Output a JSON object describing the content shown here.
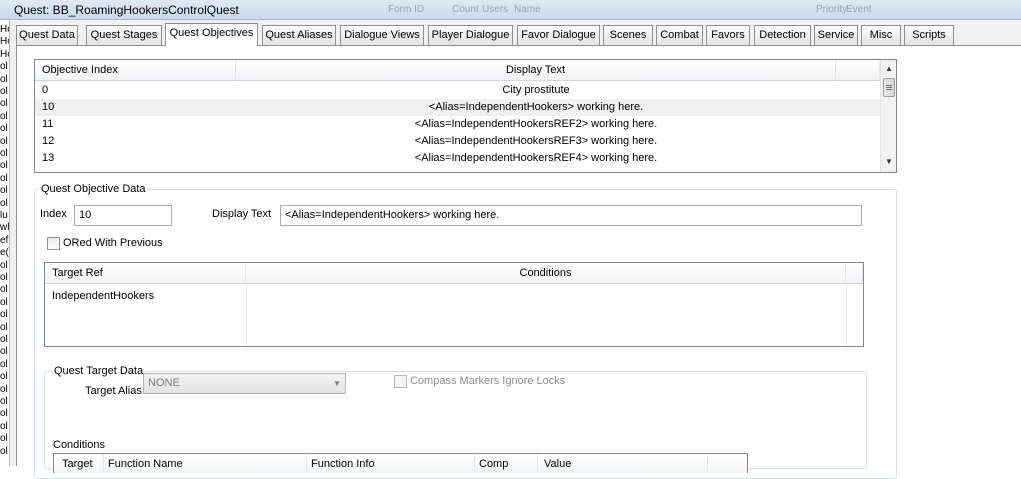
{
  "window": {
    "title": "Quest: BB_RoamingHookersControlQuest",
    "ghost_columns": [
      "Form ID",
      "Count",
      "Users",
      "Name",
      "Priority",
      "Event"
    ]
  },
  "background_strip": [
    "Ho",
    "Ho",
    "Ho",
    "ol",
    "ol",
    "ol",
    "ol",
    "ol",
    "ol",
    "ol",
    "ol",
    "ol",
    "ol",
    "ol",
    "ol",
    "lu",
    "wl",
    "ef",
    "e(",
    "ol",
    "ol",
    "ol",
    "ol",
    "ol",
    "ol",
    "ol",
    "ol",
    "ol",
    "ol",
    "ol",
    "ol",
    "ol",
    "ol",
    "ol",
    "ol"
  ],
  "tabs": [
    {
      "label": "Quest Data",
      "active": false
    },
    {
      "label": "Quest Stages",
      "active": false
    },
    {
      "label": "Quest Objectives",
      "active": true
    },
    {
      "label": "Quest Aliases",
      "active": false
    },
    {
      "label": "Dialogue Views",
      "active": false
    },
    {
      "label": "Player Dialogue",
      "active": false
    },
    {
      "label": "Favor Dialogue",
      "active": false
    },
    {
      "label": "Scenes",
      "active": false
    },
    {
      "label": "Combat",
      "active": false
    },
    {
      "label": "Favors",
      "active": false
    },
    {
      "label": "Detection",
      "active": false
    },
    {
      "label": "Service",
      "active": false
    },
    {
      "label": "Misc",
      "active": false
    },
    {
      "label": "Scripts",
      "active": false
    }
  ],
  "objectives_list": {
    "columns": [
      "Objective Index",
      "Display Text"
    ],
    "rows": [
      {
        "index": "0",
        "text": "City prostitute",
        "selected": false
      },
      {
        "index": "10",
        "text": "<Alias=IndependentHookers> working here.",
        "selected": true
      },
      {
        "index": "11",
        "text": "<Alias=IndependentHookersREF2> working here.",
        "selected": false
      },
      {
        "index": "12",
        "text": "<Alias=IndependentHookersREF3> working here.",
        "selected": false
      },
      {
        "index": "13",
        "text": "<Alias=IndependentHookersREF4> working here.",
        "selected": false
      }
    ]
  },
  "objective_data": {
    "group_label": "Quest Objective Data",
    "index_label": "Index",
    "index_value": "10",
    "display_text_label": "Display Text",
    "display_text_value": "<Alias=IndependentHookers> working here.",
    "ored_label": "ORed With Previous",
    "ored_checked": false
  },
  "targets_list": {
    "columns": [
      "Target Ref",
      "Conditions"
    ],
    "rows": [
      {
        "ref": "IndependentHookers",
        "conditions": ""
      }
    ]
  },
  "target_data": {
    "group_label": "Quest Target Data",
    "target_alias_label": "Target Alias",
    "target_alias_value": "NONE",
    "compass_label": "Compass Markers Ignore Locks",
    "compass_checked": false,
    "conditions_label": "Conditions",
    "conditions_columns": [
      "Target",
      "Function Name",
      "Function Info",
      "Comp",
      "Value"
    ]
  },
  "colors": {
    "selected_row": "#f0f0f0",
    "dialog_bg": "#f0f0f0",
    "panel_bg": "#ffffff",
    "border": "#828790"
  }
}
